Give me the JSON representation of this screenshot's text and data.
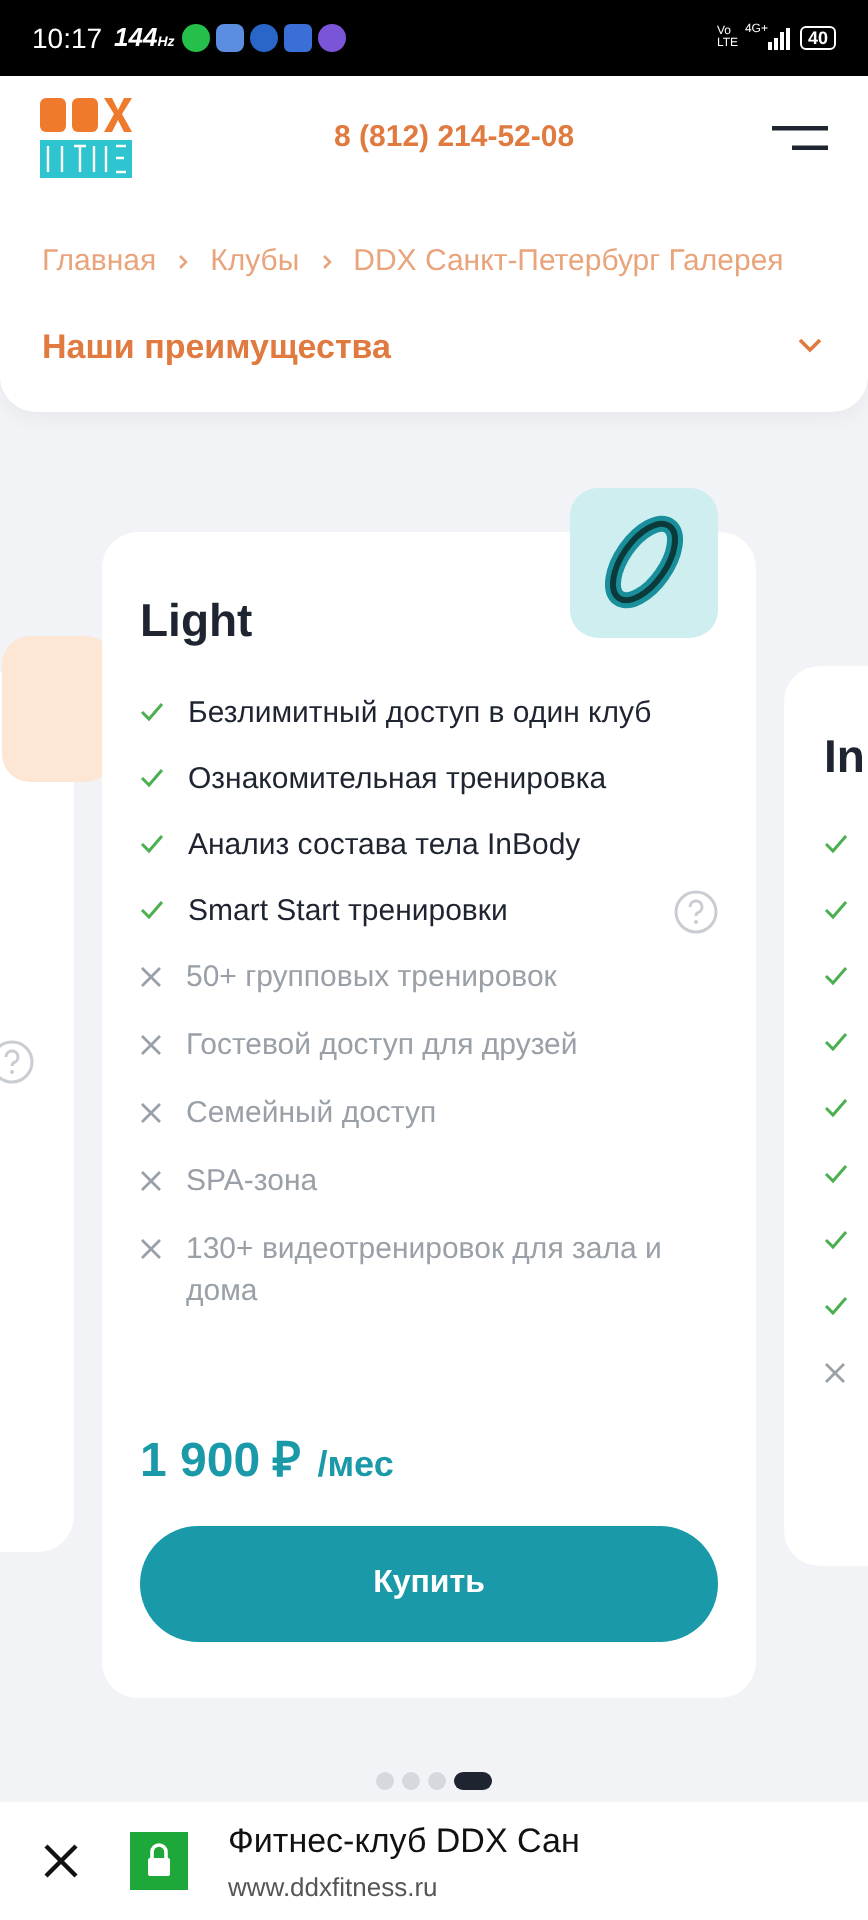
{
  "status_bar": {
    "time": "10:17",
    "refresh": "144",
    "refresh_unit": "Hz",
    "volte": "Vo LTE",
    "network": "4G+",
    "battery": "40"
  },
  "header": {
    "phone": "8 (812) 214-52-08"
  },
  "breadcrumbs": [
    {
      "label": "Главная"
    },
    {
      "label": "Клубы"
    },
    {
      "label": "DDX Санкт-Петербург Галерея"
    }
  ],
  "section_dropdown": {
    "label": "Наши преимущества",
    "expanded": false
  },
  "cards": [
    {
      "kind": "side-left"
    },
    {
      "kind": "main",
      "title": "Light",
      "features": [
        {
          "label": "Безлимитный доступ в один клуб",
          "included": true,
          "help": false
        },
        {
          "label": "Ознакомительная тренировка",
          "included": true,
          "help": false
        },
        {
          "label": "Анализ состава тела InBody",
          "included": true,
          "help": false
        },
        {
          "label": "Smart Start тренировки",
          "included": true,
          "help": true
        },
        {
          "label": "50+ групповых тренировок",
          "included": false,
          "help": false
        },
        {
          "label": "Гостевой доступ для друзей",
          "included": false,
          "help": false
        },
        {
          "label": "Семейный доступ",
          "included": false,
          "help": false
        },
        {
          "label": "SPA-зона",
          "included": false,
          "help": false
        },
        {
          "label": "130+ видеотренировок для зала и дома",
          "included": false,
          "help": false
        }
      ],
      "price": "1 900 ₽",
      "period": "/мес",
      "button": "Купить"
    },
    {
      "kind": "side-right",
      "title": "In",
      "features": [
        {
          "included": true
        },
        {
          "included": true
        },
        {
          "included": true
        },
        {
          "included": true
        },
        {
          "included": true
        },
        {
          "included": true
        },
        {
          "included": true
        },
        {
          "included": true
        },
        {
          "included": false
        }
      ]
    }
  ],
  "carousel_dots": [
    {
      "selected": false
    },
    {
      "selected": false
    },
    {
      "selected": false
    },
    {
      "selected": true
    }
  ],
  "browser_bar": {
    "title": "Фитнес-клуб DDX Сан",
    "url": "www.ddxfitness.ru"
  }
}
